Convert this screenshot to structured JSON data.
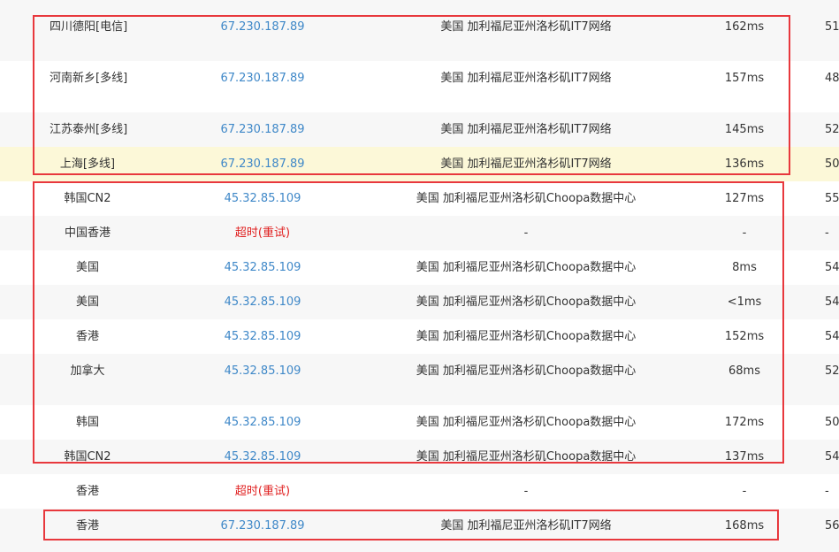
{
  "rows": [
    {
      "node": "四川德阳[电信]",
      "ip": "67.230.187.89",
      "location": "美国 加利福尼亚州洛杉矶IT7网络",
      "time": "162ms",
      "ttl": "51"
    },
    {
      "node": "河南新乡[多线]",
      "ip": "67.230.187.89",
      "location": "美国 加利福尼亚州洛杉矶IT7网络",
      "time": "157ms",
      "ttl": "48"
    },
    {
      "node": "江苏泰州[多线]",
      "ip": "67.230.187.89",
      "location": "美国 加利福尼亚州洛杉矶IT7网络",
      "time": "145ms",
      "ttl": "52"
    },
    {
      "node": "上海[多线]",
      "ip": "67.230.187.89",
      "location": "美国 加利福尼亚州洛杉矶IT7网络",
      "time": "136ms",
      "ttl": "50"
    },
    {
      "node": "韩国CN2",
      "ip": "45.32.85.109",
      "location": "美国 加利福尼亚州洛杉矶Choopa数据中心",
      "time": "127ms",
      "ttl": "55"
    },
    {
      "node": "中国香港",
      "ip_timeout": "超时",
      "ip_retry": "(重试)",
      "location": "-",
      "time": "-",
      "ttl": "-"
    },
    {
      "node": "美国",
      "ip": "45.32.85.109",
      "location": "美国 加利福尼亚州洛杉矶Choopa数据中心",
      "time": "8ms",
      "ttl": "54"
    },
    {
      "node": "美国",
      "ip": "45.32.85.109",
      "location": "美国 加利福尼亚州洛杉矶Choopa数据中心",
      "time": "<1ms",
      "ttl": "54"
    },
    {
      "node": "香港",
      "ip": "45.32.85.109",
      "location": "美国 加利福尼亚州洛杉矶Choopa数据中心",
      "time": "152ms",
      "ttl": "54"
    },
    {
      "node": "加拿大",
      "ip": "45.32.85.109",
      "location": "美国 加利福尼亚州洛杉矶Choopa数据中心",
      "time": "68ms",
      "ttl": "52"
    },
    {
      "node": "韩国",
      "ip": "45.32.85.109",
      "location": "美国 加利福尼亚州洛杉矶Choopa数据中心",
      "time": "172ms",
      "ttl": "50"
    },
    {
      "node": "韩国CN2",
      "ip": "45.32.85.109",
      "location": "美国 加利福尼亚州洛杉矶Choopa数据中心",
      "time": "137ms",
      "ttl": "54"
    },
    {
      "node": "香港",
      "ip_timeout": "超时",
      "ip_retry": "(重试)",
      "location": "-",
      "time": "-",
      "ttl": "-"
    },
    {
      "node": "香港",
      "ip": "67.230.187.89",
      "location": "美国 加利福尼亚州洛杉矶IT7网络",
      "time": "168ms",
      "ttl": "56"
    }
  ]
}
